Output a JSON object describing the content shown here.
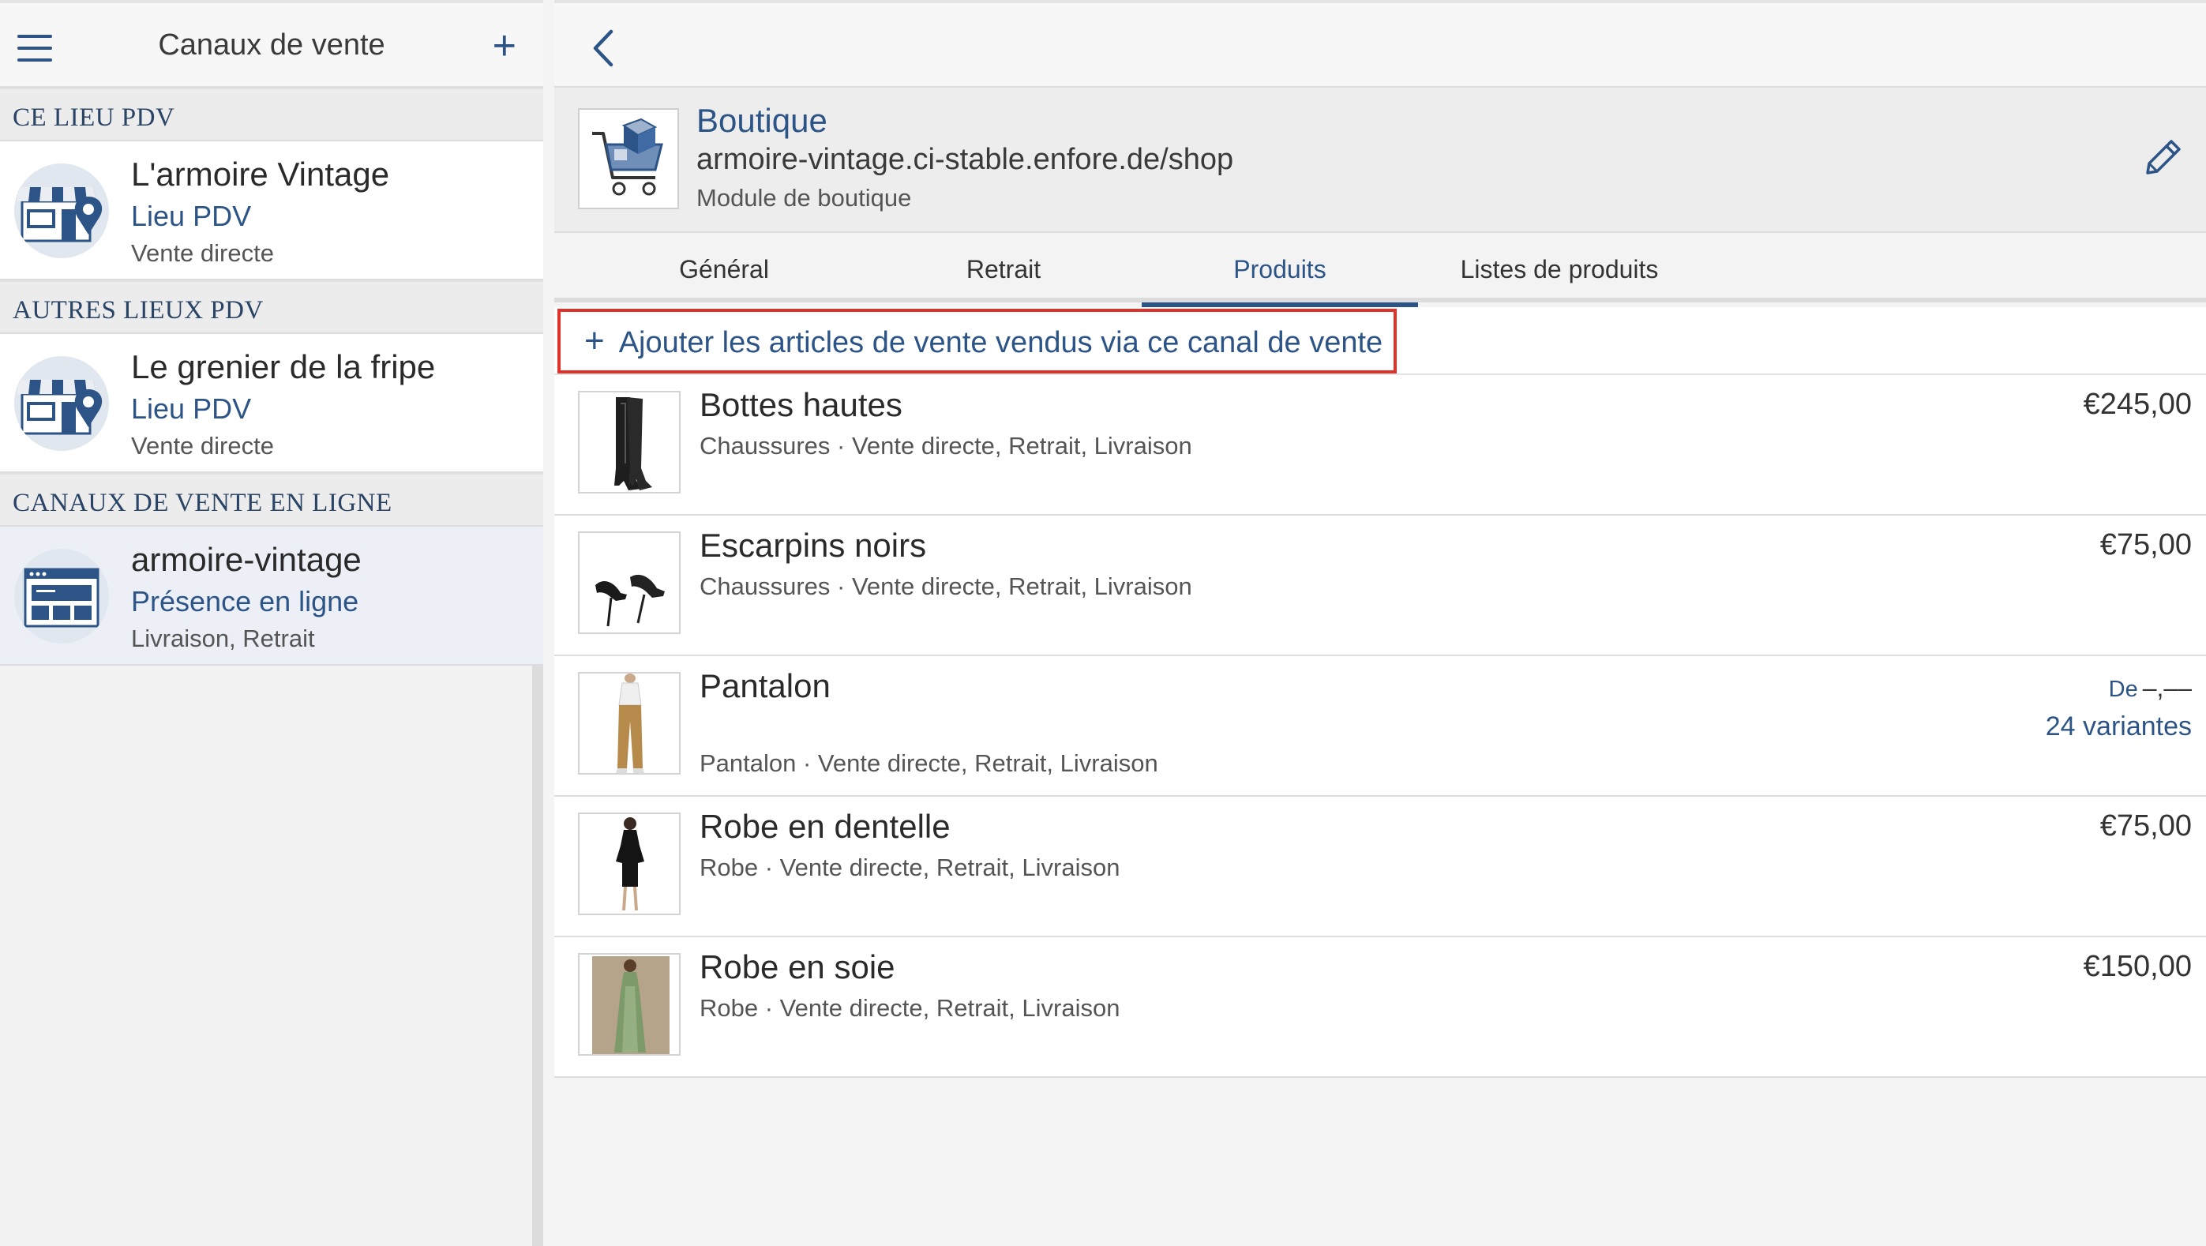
{
  "sidebar": {
    "title": "Canaux de vente",
    "add_icon": "plus-icon",
    "menu_icon": "hamburger-icon",
    "sections": [
      {
        "header": "CE LIEU PDV",
        "items": [
          {
            "name": "L'armoire Vintage",
            "type": "Lieu PDV",
            "mode": "Vente directe",
            "icon": "store-location-icon"
          }
        ]
      },
      {
        "header": "AUTRES LIEUX PDV",
        "items": [
          {
            "name": "Le grenier de la fripe",
            "type": "Lieu PDV",
            "mode": "Vente directe",
            "icon": "store-location-icon"
          }
        ]
      },
      {
        "header": "CANAUX DE VENTE EN LIGNE",
        "items": [
          {
            "name": "armoire-vintage",
            "type": "Présence en ligne",
            "mode": "Livraison, Retrait",
            "icon": "browser-window-icon",
            "selected": true
          }
        ]
      }
    ]
  },
  "main": {
    "back_icon": "chevron-left-icon",
    "shop": {
      "title": "Boutique",
      "url": "armoire-vintage.ci-stable.enfore.de/shop",
      "module": "Module de boutique",
      "logo_icon": "shopping-cart-icon",
      "edit_icon": "pencil-icon"
    },
    "tabs": [
      {
        "label": "Général",
        "active": false
      },
      {
        "label": "Retrait",
        "active": false
      },
      {
        "label": "Produits",
        "active": true
      },
      {
        "label": "Listes de produits",
        "active": false
      }
    ],
    "add_articles_label": "Ajouter les articles de vente vendus via ce canal de vente",
    "products": [
      {
        "name": "Bottes hautes",
        "meta": "Chaussures · Vente directe, Retrait, Livraison",
        "price": "€245,00",
        "thumb": "boots"
      },
      {
        "name": "Escarpins noirs",
        "meta": "Chaussures · Vente directe, Retrait, Livraison",
        "price": "€75,00",
        "thumb": "heels"
      },
      {
        "name": "Pantalon",
        "meta": "Pantalon · Vente directe, Retrait, Livraison",
        "price_from_label": "De",
        "price_from_value": "–,––",
        "variants": "24 variantes",
        "thumb": "trousers"
      },
      {
        "name": "Robe en dentelle",
        "meta": "Robe · Vente directe, Retrait, Livraison",
        "price": "€75,00",
        "thumb": "lace-dress"
      },
      {
        "name": "Robe en soie",
        "meta": "Robe · Vente directe, Retrait, Livraison",
        "price": "€150,00",
        "thumb": "silk-dress"
      }
    ]
  },
  "colors": {
    "accent": "#2d5486",
    "highlight_border": "#e0322b",
    "selected_bg": "#ecf0f6"
  }
}
